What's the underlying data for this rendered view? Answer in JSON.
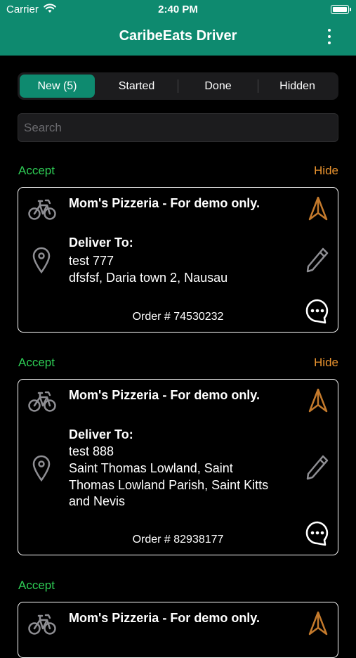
{
  "status_bar": {
    "carrier": "Carrier",
    "time": "2:40 PM"
  },
  "app": {
    "title": "CaribeEats Driver"
  },
  "tabs": [
    {
      "label": "New (5)",
      "active": true
    },
    {
      "label": "Started",
      "active": false
    },
    {
      "label": "Done",
      "active": false
    },
    {
      "label": "Hidden",
      "active": false
    }
  ],
  "search": {
    "placeholder": "Search",
    "value": ""
  },
  "orders": [
    {
      "accept_label": "Accept",
      "hide_label": "Hide",
      "restaurant": "Mom's Pizzeria - For demo only.",
      "deliver_label": "Deliver To:",
      "customer": "test 777",
      "address_lines": [
        "dfsfsf,  Daria town 2,  Nausau"
      ],
      "order_number": "Order # 74530232"
    },
    {
      "accept_label": "Accept",
      "hide_label": "Hide",
      "restaurant": "Mom's Pizzeria - For demo only.",
      "deliver_label": "Deliver To:",
      "customer": "test 888",
      "address_lines": [
        "Saint Thomas Lowland, Saint",
        "Thomas Lowland Parish, Saint Kitts",
        "and Nevis"
      ],
      "order_number": "Order # 82938177"
    },
    {
      "accept_label": "Accept",
      "restaurant": "Mom's Pizzeria - For demo only."
    }
  ],
  "colors": {
    "brand": "#0e8a6f",
    "accept": "#2ecc55",
    "hide": "#e8922e",
    "navigate_icon": "#c47a2c",
    "icon_gray": "#8e8e93"
  },
  "icons": {
    "bike": "bicycle-icon",
    "pin": "location-pin-icon",
    "navigate": "navigation-arrow-icon",
    "edit": "pencil-icon",
    "chat": "chat-bubble-icon",
    "menu": "more-vertical-icon"
  }
}
